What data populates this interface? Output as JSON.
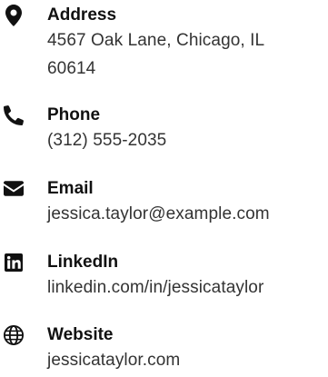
{
  "contact": {
    "address": {
      "label": "Address",
      "line1": "4567 Oak Lane, Chicago, IL",
      "line2": "60614",
      "icon": "map-pin-icon"
    },
    "phone": {
      "label": "Phone",
      "value": "(312) 555-2035",
      "icon": "phone-icon"
    },
    "email": {
      "label": "Email",
      "value": "jessica.taylor@example.com",
      "icon": "envelope-icon"
    },
    "linkedin": {
      "label": "LinkedIn",
      "value": "linkedin.com/in/jessicataylor",
      "icon": "linkedin-icon"
    },
    "website": {
      "label": "Website",
      "value": "jessicataylor.com",
      "icon": "globe-icon"
    }
  }
}
